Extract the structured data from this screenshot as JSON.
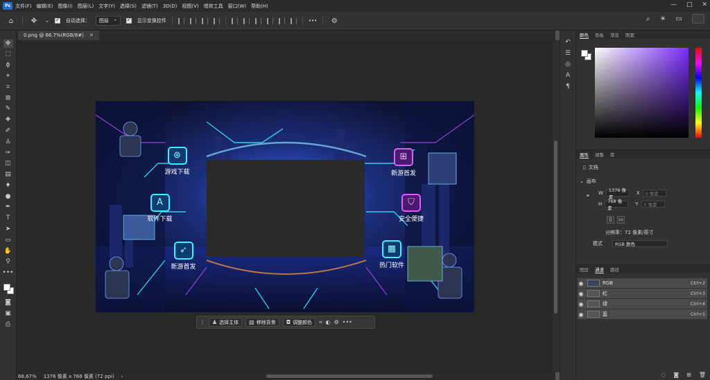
{
  "menubar": {
    "items": [
      "文件(F)",
      "编辑(E)",
      "图像(I)",
      "图层(L)",
      "文字(Y)",
      "选择(S)",
      "滤镜(T)",
      "3D(D)",
      "视图(V)",
      "增效工具",
      "窗口(W)",
      "帮助(H)"
    ],
    "window_controls": [
      "—",
      "□",
      "✕"
    ]
  },
  "options": {
    "auto_select_label": "自动选择：",
    "auto_select_value": "图层",
    "show_transform_label": "显示变换控件",
    "more": "•••"
  },
  "document": {
    "tab_title": "0.png @ 66.7%(RGB/8#)",
    "tab_close": "✕"
  },
  "image": {
    "buttons": [
      {
        "label": "游戏下载",
        "icon": "gamepad-icon"
      },
      {
        "label": "软件下载",
        "icon": "app-store-icon"
      },
      {
        "label": "新游首发",
        "icon": "rocket-icon"
      },
      {
        "label": "新游首发",
        "icon": "gift-icon"
      },
      {
        "label": "安全便捷",
        "icon": "shield-icon"
      },
      {
        "label": "热门软件",
        "icon": "apps-grid-icon"
      }
    ]
  },
  "taskbar": {
    "select_subject": "选择主体",
    "remove_bg": "移除背景",
    "adjust_color": "调整颜色",
    "more": "•••"
  },
  "status": {
    "zoom": "66.67%",
    "size": "1376 像素 x 768 像素 (72 ppi)",
    "arrow": "›"
  },
  "color_panel": {
    "tabs": [
      "颜色",
      "色板",
      "渐变",
      "图案"
    ],
    "active_tab": "颜色"
  },
  "props_panel": {
    "tabs": [
      "属性",
      "调整",
      "库"
    ],
    "active_tab": "属性",
    "doc_label": "文档",
    "section": "画布",
    "w_label": "W",
    "w_value": "1376 像素",
    "h_label": "H",
    "h_value": "768 像素",
    "x_label": "X",
    "x_value": "0 像素",
    "y_label": "Y",
    "y_value": "0 像素",
    "resolution": "分辨率：72 像素/英寸",
    "mode_label": "模式",
    "mode_value": "RGB 颜色"
  },
  "channels_panel": {
    "tabs": [
      "图层",
      "通道",
      "路径"
    ],
    "active_tab": "通道",
    "rows": [
      {
        "name": "RGB",
        "key": "Ctrl+2"
      },
      {
        "name": "红",
        "key": "Ctrl+3"
      },
      {
        "name": "绿",
        "key": "Ctrl+4"
      },
      {
        "name": "蓝",
        "key": "Ctrl+5"
      }
    ]
  }
}
